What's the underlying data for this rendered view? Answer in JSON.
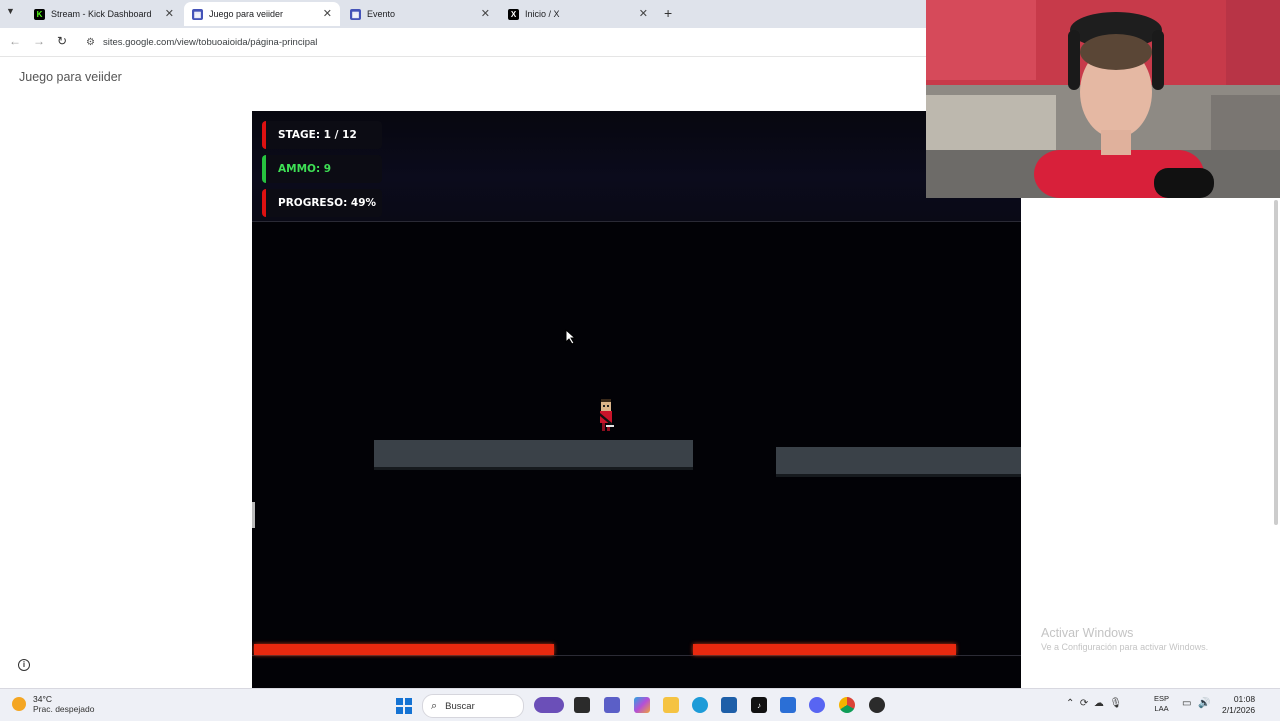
{
  "browser": {
    "tabs": [
      {
        "title": "Stream - Kick Dashboard",
        "icon": "kick-icon",
        "color": "#53fc18"
      },
      {
        "title": "Juego para veiider",
        "icon": "google-sites-icon",
        "color": "#4453b8",
        "active": true
      },
      {
        "title": "Evento",
        "icon": "google-sites-icon",
        "color": "#4453b8"
      },
      {
        "title": "Inicio / X",
        "icon": "x-icon",
        "color": "#000000"
      }
    ],
    "url": "sites.google.com/view/tobuoaioida/página-principal"
  },
  "page": {
    "site_title": "Juego para veiider"
  },
  "game": {
    "hud": {
      "stage": "STAGE: 1 / 12",
      "ammo": "AMMO: 9",
      "progress": "PROGRESO: 49%"
    },
    "colors": {
      "background": "#020206",
      "platform": "#3a4148",
      "lava": "#e8290f",
      "stage_accent": "#dd1111",
      "ammo_accent": "#27c23f"
    }
  },
  "watermark": {
    "title": "Activar Windows",
    "subtitle": "Ve a Configuración para activar Windows."
  },
  "taskbar": {
    "weather_temp": "34°C",
    "weather_desc": "Prac. despejado",
    "search_placeholder": "Buscar",
    "lang_line1": "ESP",
    "lang_line2": "LAA",
    "time": "01:08",
    "date": "2/1/2026"
  }
}
